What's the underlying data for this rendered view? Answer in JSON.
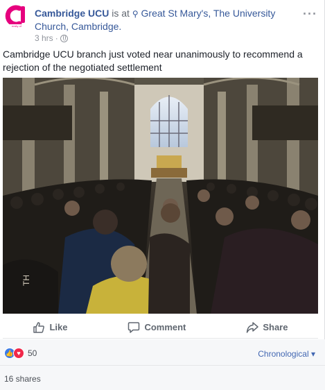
{
  "post": {
    "page_name": "Cambridge UCU",
    "is_at_text": " is at ",
    "place": "Great St Mary's, The University Church, Cambridge.",
    "time": "3 hrs",
    "separator": "·",
    "privacy_icon": "globe-icon",
    "more_icon": "ellipsis-icon",
    "text": "Cambridge UCU branch just voted near unanimously to recommend a rejection of the negotiated settlement"
  },
  "actions": {
    "like_label": "Like",
    "comment_label": "Comment",
    "share_label": "Share"
  },
  "reactions": {
    "icons": [
      "like-reaction-icon",
      "love-reaction-icon"
    ],
    "count": "50",
    "sort_label": "Chronological",
    "shares": "16 shares"
  },
  "colors": {
    "link_blue": "#365899",
    "like_blue": "#3b7be8",
    "love_red": "#f0284a",
    "avatar_pink": "#e6007e"
  }
}
